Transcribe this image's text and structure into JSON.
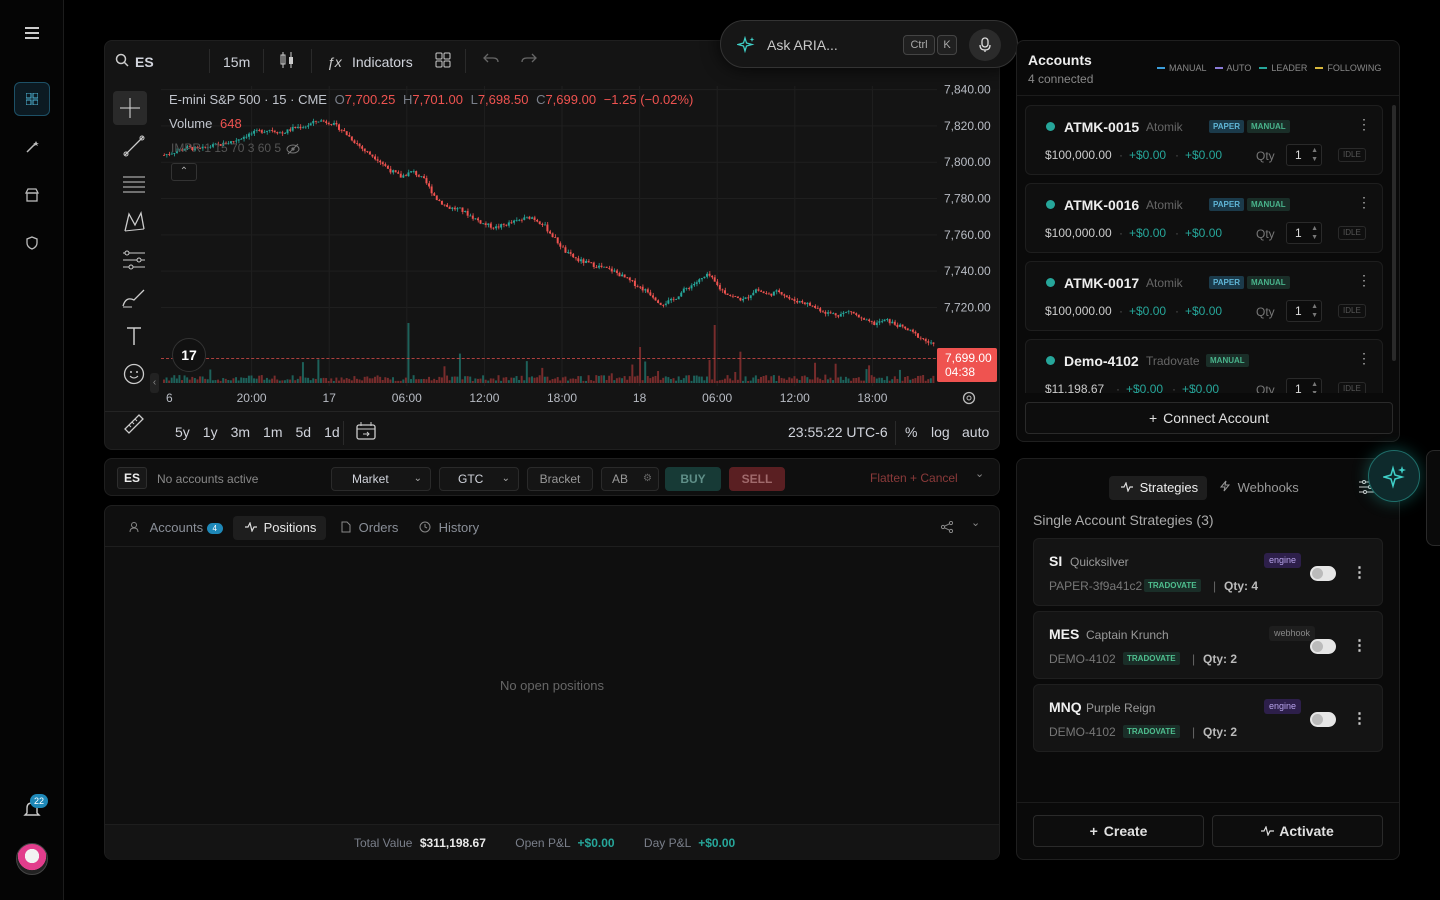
{
  "sidebar": {
    "notifications_count": "22"
  },
  "toolbar": {
    "symbol": "ES",
    "interval": "15m",
    "indicators_label": "Indicators"
  },
  "aria": {
    "placeholder": "Ask ARIA...",
    "shortcut_ctrl": "Ctrl",
    "shortcut_key": "K"
  },
  "legend": {
    "title": "E-mini S&P 500 · 15 · CME",
    "o_label": "O",
    "o_val": "7,700.25",
    "h_label": "H",
    "h_val": "7,701.00",
    "l_label": "L",
    "l_val": "7,698.50",
    "c_label": "C",
    "c_val": "7,699.00",
    "change": "−1.25 (−0.02%)",
    "volume_label": "Volume",
    "volume_val": "648",
    "indicator": "IMPR 1 15 70 3 60 5"
  },
  "price_tag": {
    "price": "7,699.00",
    "countdown": "04:38"
  },
  "bottom_toolbar": {
    "ranges": [
      "5y",
      "1y",
      "3m",
      "1m",
      "5d",
      "1d"
    ],
    "clock": "23:55:22 UTC-6",
    "pct": "%",
    "log": "log",
    "auto": "auto"
  },
  "chart_data": {
    "type": "candlestick",
    "title": "E-mini S&P 500 · 15 · CME",
    "y_ticks": [
      "7,840.00",
      "7,820.00",
      "7,800.00",
      "7,780.00",
      "7,760.00",
      "7,740.00",
      "7,720.00"
    ],
    "ylim": [
      7685,
      7842
    ],
    "x_ticks": [
      "6",
      "20:00",
      "17",
      "06:00",
      "12:00",
      "18:00",
      "18",
      "06:00",
      "12:00",
      "18:00"
    ],
    "close_path": [
      7804,
      7806,
      7808,
      7807,
      7809,
      7810,
      7812,
      7815,
      7817,
      7818,
      7816,
      7819,
      7820,
      7823,
      7822,
      7818,
      7812,
      7806,
      7802,
      7796,
      7792,
      7795,
      7790,
      7780,
      7775,
      7774,
      7770,
      7766,
      7764,
      7766,
      7768,
      7770,
      7766,
      7758,
      7750,
      7746,
      7744,
      7742,
      7740,
      7736,
      7732,
      7728,
      7722,
      7724,
      7730,
      7734,
      7738,
      7730,
      7726,
      7724,
      7730,
      7727,
      7729,
      7724,
      7723,
      7720,
      7717,
      7716,
      7718,
      7713,
      7711,
      7713,
      7710,
      7707,
      7703,
      7699
    ]
  },
  "order_bar": {
    "symbol": "ES",
    "status": "No accounts active",
    "order_type": "Market",
    "tif": "GTC",
    "bracket": "Bracket",
    "ab": "AB",
    "buy": "BUY",
    "sell": "SELL",
    "flatten": "Flatten + Cancel"
  },
  "positions_panel": {
    "tabs": {
      "accounts": "Accounts",
      "accounts_count": "4",
      "positions": "Positions",
      "orders": "Orders",
      "history": "History"
    },
    "empty": "No open positions",
    "footer": {
      "total_label": "Total Value",
      "total": "$311,198.67",
      "open_label": "Open P&L",
      "open": "+$0.00",
      "day_label": "Day P&L",
      "day": "+$0.00"
    }
  },
  "accounts": {
    "title": "Accounts",
    "subtitle": "4 connected",
    "legend": [
      {
        "label": "MANUAL",
        "color": "#3b9edb"
      },
      {
        "label": "AUTO",
        "color": "#8b7bd8"
      },
      {
        "label": "LEADER",
        "color": "#26a69a"
      },
      {
        "label": "FOLLOWING",
        "color": "#d8b83b"
      }
    ],
    "items": [
      {
        "id": "ATMK-0015",
        "broker": "Atomik",
        "badge1": "PAPER",
        "badge2": "MANUAL",
        "balance": "$100,000.00",
        "pnl1": "+$0.00",
        "pnl2": "+$0.00",
        "qty_label": "Qty",
        "qty": "1",
        "status": "IDLE"
      },
      {
        "id": "ATMK-0016",
        "broker": "Atomik",
        "badge1": "PAPER",
        "badge2": "MANUAL",
        "balance": "$100,000.00",
        "pnl1": "+$0.00",
        "pnl2": "+$0.00",
        "qty_label": "Qty",
        "qty": "1",
        "status": "IDLE"
      },
      {
        "id": "ATMK-0017",
        "broker": "Atomik",
        "badge1": "PAPER",
        "badge2": "MANUAL",
        "balance": "$100,000.00",
        "pnl1": "+$0.00",
        "pnl2": "+$0.00",
        "qty_label": "Qty",
        "qty": "1",
        "status": "IDLE"
      },
      {
        "id": "Demo-4102",
        "broker": "Tradovate",
        "badge1": "MANUAL",
        "balance": "$11,198.67",
        "pnl1": "+$0.00",
        "pnl2": "+$0.00",
        "qty_label": "Qty",
        "qty": "1",
        "status": "IDLE"
      }
    ],
    "connect_label": "Connect Account"
  },
  "strategies": {
    "tab_strategies": "Strategies",
    "tab_webhooks": "Webhooks",
    "heading": "Single Account Strategies (3)",
    "items": [
      {
        "symbol": "SI",
        "name": "Quicksilver",
        "tag": "engine",
        "account": "PAPER-3f9a41c2",
        "broker": "TRADOVATE",
        "qty": "Qty: 4"
      },
      {
        "symbol": "MES",
        "name": "Captain Krunch",
        "tag": "webhook",
        "account": "DEMO-4102",
        "broker": "TRADOVATE",
        "qty": "Qty: 2"
      },
      {
        "symbol": "MNQ",
        "name": "Purple Reign",
        "tag": "engine",
        "account": "DEMO-4102",
        "broker": "TRADOVATE",
        "qty": "Qty: 2"
      }
    ],
    "create_label": "Create",
    "activate_label": "Activate"
  }
}
